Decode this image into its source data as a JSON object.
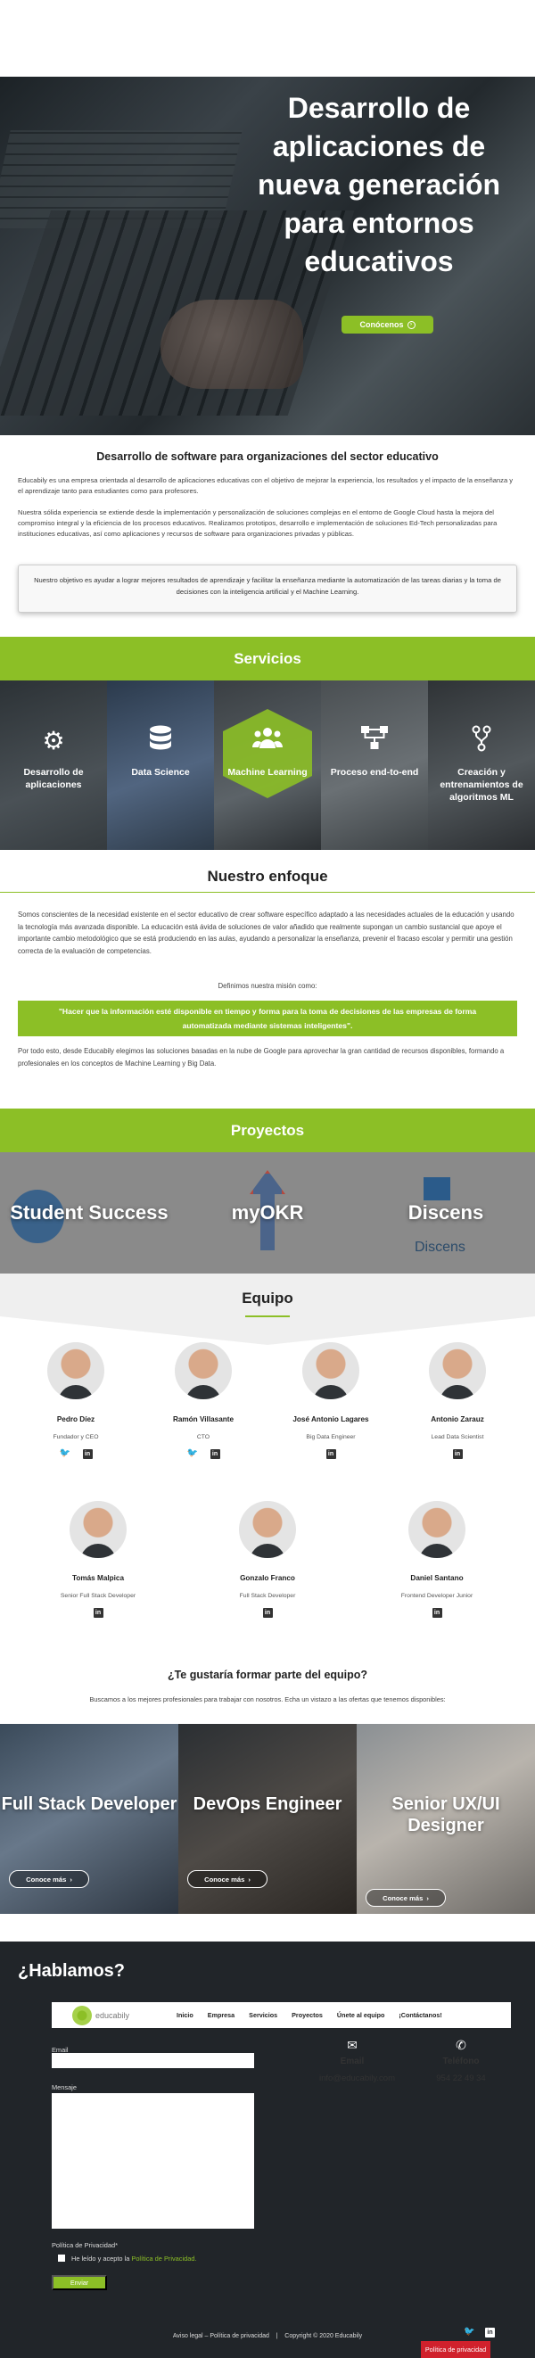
{
  "hero": {
    "title": "Desarrollo de aplicaciones de nueva generación para entornos educativos",
    "button_label": "Conócenos"
  },
  "intro": {
    "heading": "Desarrollo de software para organizaciones del sector educativo",
    "p1": "Educabily es una empresa orientada al desarrollo de aplicaciones educativas con el objetivo de mejorar la experiencia, los resultados y el impacto de la enseñanza y el aprendizaje tanto para estudiantes como para profesores.",
    "p2": "Nuestra sólida experiencia se extiende desde la implementación y personalización de soluciones complejas en el entorno de Google Cloud hasta la mejora del compromiso integral y la eficiencia de los procesos educativos. Realizamos prototipos, desarrollo e implementación de soluciones Ed-Tech personalizadas para instituciones educativas, así como aplicaciones y recursos de software para organizaciones privadas y públicas.",
    "quote": "Nuestro objetivo es ayudar a lograr mejores resultados de aprendizaje y facilitar la enseñanza mediante la automatización de las tareas diarias y la toma de decisiones con la inteligencia artificial y el Machine Learning."
  },
  "services": {
    "title": "Servicios",
    "items": [
      {
        "label": "Desarrollo de aplicaciones",
        "icon": "gear-icon"
      },
      {
        "label": "Data Science",
        "icon": "database-icon"
      },
      {
        "label": "Machine Learning",
        "icon": "users-icon"
      },
      {
        "label": "Proceso end-to-end",
        "icon": "flow-icon"
      },
      {
        "label": "Creación y entrenamientos de algoritmos ML",
        "icon": "branch-icon"
      }
    ]
  },
  "approach": {
    "title": "Nuestro enfoque",
    "p1": "Somos conscientes de la necesidad existente en el sector educativo de crear software específico adaptado a las necesidades actuales de la educación y usando la tecnología más avanzada disponible. La educación está ávida de soluciones de valor añadido que realmente supongan un cambio sustancial que apoye el importante cambio metodológico que se está produciendo en las aulas, ayudando a personalizar la enseñanza, prevenir el fracaso escolar y permitir una gestión correcta de la evaluación de competencias.",
    "mission_label": "Definimos nuestra misión como:",
    "mission": "\"Hacer que la información esté disponible en tiempo y forma para la toma de decisiones de las empresas de forma automatizada mediante sistemas inteligentes\".",
    "p2": "Por todo esto, desde Educabily elegimos las soluciones basadas en la nube de Google para aprovechar la gran cantidad de recursos disponibles, formando a profesionales en los conceptos de Machine Learning y Big Data."
  },
  "projects": {
    "title": "Proyectos",
    "items": [
      {
        "label": "Student Success"
      },
      {
        "label": "myOKR"
      },
      {
        "label": "Discens",
        "sub": "Discens"
      }
    ]
  },
  "team": {
    "title": "Equipo",
    "members": [
      {
        "name": "Pedro Díez",
        "role": "Fundador y CEO"
      },
      {
        "name": "Ramón Villasante",
        "role": "CTO"
      },
      {
        "name": "José Antonio Lagares",
        "role": "Big Data Engineer"
      },
      {
        "name": "Antonio Zarauz",
        "role": "Lead Data Scientist"
      },
      {
        "name": "Tomás Malpica",
        "role": "Senior Full Stack Developer"
      },
      {
        "name": "Gonzalo Franco",
        "role": "Full Stack Developer"
      },
      {
        "name": "Daniel Santano",
        "role": "Frontend Developer Junior"
      }
    ],
    "join_title": "¿Te gustaría formar parte del equipo?",
    "join_sub": "Buscamos a los mejores profesionales para trabajar con nosotros. Echa un vistazo a las ofertas que tenemos disponibles:"
  },
  "jobs": [
    {
      "title": "Full Stack Developer",
      "button": "Conoce más"
    },
    {
      "title": "DevOps Engineer",
      "button": "Conoce más"
    },
    {
      "title": "Senior UX/UI Designer",
      "button": "Conoce más"
    }
  ],
  "footer": {
    "title": "¿Hablamos?",
    "brand": "educabily",
    "nav": [
      "Inicio",
      "Empresa",
      "Servicios",
      "Proyectos",
      "Únete al equipo",
      "¡Contáctanos!"
    ],
    "email_label": "Email",
    "message_label": "Mensaje",
    "privacy_label": "Política de Privacidad*",
    "privacy_check_text": "He leído y acepto la",
    "privacy_link": "Política de Privacidad.",
    "send": "Enviar",
    "contact_email_title": "Email",
    "contact_email": "info@educabily.com",
    "contact_phone_title": "Teléfono",
    "contact_phone": "954 22 49 34",
    "legal": "Aviso legal – Política de privacidad",
    "copyright": "Copyright © 2020 Educabily",
    "privacy_tab": "Política de privacidad",
    "accent": "#8cbf26"
  }
}
